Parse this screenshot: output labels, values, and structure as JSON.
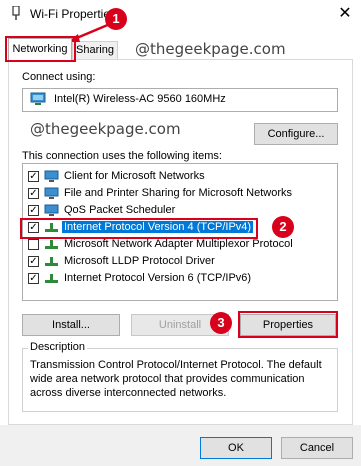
{
  "window": {
    "title": "Wi-Fi Properties",
    "close_glyph": "✕"
  },
  "tabs": [
    {
      "label": "Networking",
      "selected": true
    },
    {
      "label": "Sharing",
      "selected": false
    }
  ],
  "watermark": "@thegeekpage.com",
  "connect_using": {
    "label": "Connect using:",
    "adapter": "Intel(R) Wireless-AC 9560 160MHz",
    "configure_button": "Configure..."
  },
  "items": {
    "label": "This connection uses the following items:",
    "list": [
      {
        "text": "Client for Microsoft Networks",
        "checked": true,
        "icon": "network-client-icon",
        "selected": false
      },
      {
        "text": "File and Printer Sharing for Microsoft Networks",
        "checked": true,
        "icon": "file-printer-sharing-icon",
        "selected": false
      },
      {
        "text": "QoS Packet Scheduler",
        "checked": true,
        "icon": "qos-scheduler-icon",
        "selected": false
      },
      {
        "text": "Internet Protocol Version 4 (TCP/IPv4)",
        "checked": true,
        "icon": "protocol-icon",
        "selected": true
      },
      {
        "text": "Microsoft Network Adapter Multiplexor Protocol",
        "checked": false,
        "icon": "protocol-icon",
        "selected": false
      },
      {
        "text": "Microsoft LLDP Protocol Driver",
        "checked": true,
        "icon": "protocol-icon",
        "selected": false
      },
      {
        "text": "Internet Protocol Version 6 (TCP/IPv6)",
        "checked": true,
        "icon": "protocol-icon",
        "selected": false
      }
    ]
  },
  "buttons": {
    "install": "Install...",
    "uninstall": "Uninstall",
    "properties": "Properties",
    "ok": "OK",
    "cancel": "Cancel"
  },
  "description": {
    "title": "Description",
    "text": "Transmission Control Protocol/Internet Protocol. The default wide area network protocol that provides communication across diverse interconnected networks."
  },
  "annotations": [
    "1",
    "2",
    "3"
  ],
  "colors": {
    "annotation_red": "#d9001b",
    "selection_blue": "#0078d7"
  }
}
